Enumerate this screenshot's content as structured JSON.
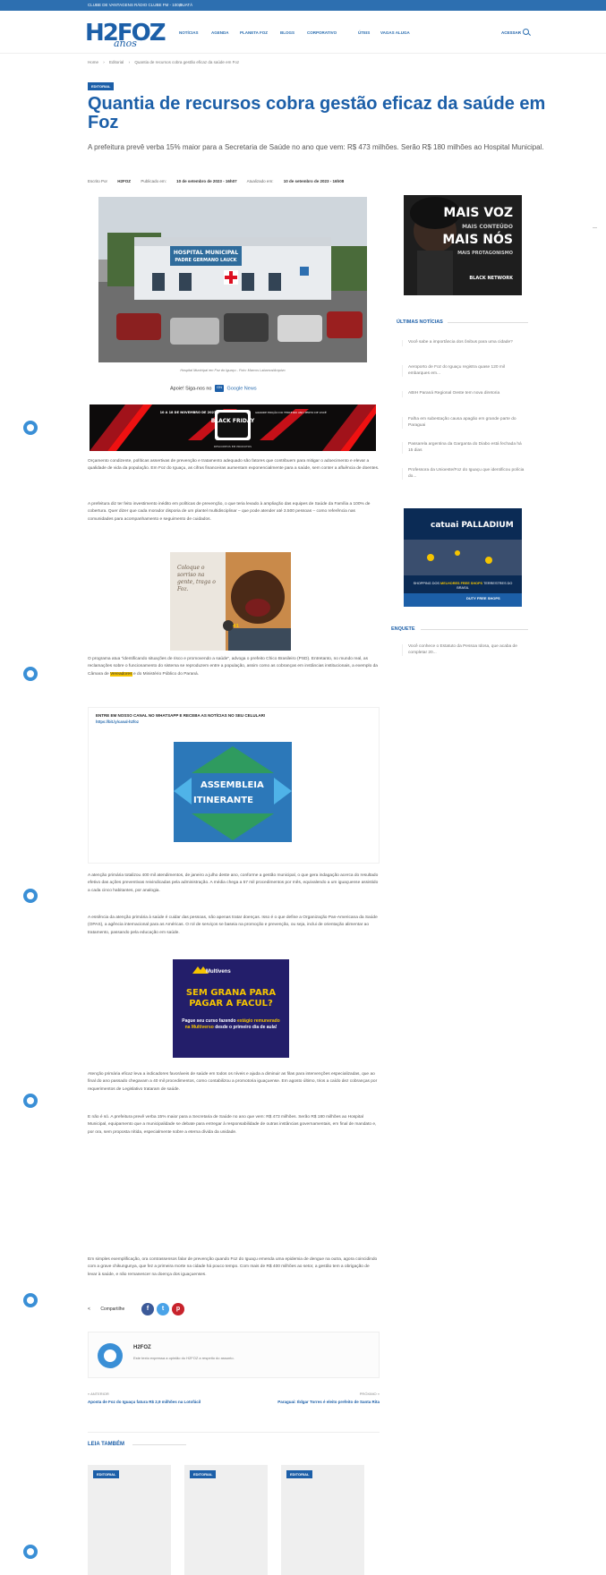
{
  "topbar": {
    "links": [
      "CLUBE DE VANTAGENS",
      "RÁDIO CLUBE FM - 100,9",
      "GUATÁ"
    ]
  },
  "header": {
    "logo_main": "H2FOZ",
    "logo_sub": "anos",
    "nav": [
      "NOTÍCIAS",
      "AGENDA",
      "PLANETA FOZ",
      "BLOGS",
      "CORPORATIVO",
      "ÚTEIS",
      "VAGAS ALUGA"
    ],
    "acessar": "ACESSAR",
    "search_icon": "search-icon"
  },
  "breadcrumb": [
    "Home",
    "›",
    "Editorial",
    "›",
    "Quantia de recursos cobra gestão eficaz da saúde em Foz"
  ],
  "article": {
    "category": "EDITORIAL",
    "title": "Quantia de recursos cobra gestão eficaz da saúde em Foz",
    "subtitle": "A prefeitura prevê verba 15% maior para a Secretaria de Saúde no ano que vem: R$ 473 milhões. Serão R$ 180 milhões ao Hospital Municipal.",
    "author_label": "Escrito Por",
    "author": "H2FOZ",
    "published_label": "Publicado em:",
    "published": "10 de setembro de 2023 - 16h07",
    "updated_label": "Atualizado em:",
    "updated": "10 de setembro de 2023 - 16h08",
    "hero_sign1": "HOSPITAL MUNICIPAL",
    "hero_sign2": "PADRE GERMANO LAUCK",
    "caption": "Hospital Municipal em Foz do Iguaçu - Foto: Marcos Labanca/Arquivo",
    "gnews_prefix": "Apoie! Siga-nos no",
    "gnews_icon": "google-news-icon",
    "gnews_text": "Google News",
    "banner": {
      "date": "10 A 18 DE NOVEMBRO DE 2023",
      "text": "BLACK FRIDAY",
      "right": "GRANDE EDIÇÃO DO TERCEIRO ANO PERTO DE VOCÊ",
      "footer": "DESCONTOS EM PRODUTOS"
    },
    "para1": "Orçamento condizente, políticas assertivas de prevenção e tratamento adequado são fatores que contribuem para mitigar o adoecimento e elevar a qualidade de vida da população. Em Foz do Iguaçu, as cifras financeiras aumentam exponencialmente para a saúde, sem conter a afluência de doentes.",
    "para2": "A prefeitura diz ter feito investimento inédito em políticas de prevenção, o que teria levado à ampliação das equipes de Saúde da Família a 100% de cobertura. Quer dizer que cada morador disporia de um plantel multidisciplinar – que pode atender até 3.500 pessoas – como referência nas comunidades para acompanhamento e seguimento de cuidados.",
    "ad_kid_text": "Coloque o sorriso na gente, traga o Foz.",
    "para3_a": "O programa atua \"identificando situações de risco e promovendo a saúde\", advoga o prefeito Chico Brasileiro (PSD). Entretanto, no mundo real, as reclamações sobre o funcionamento do sistema se reproduzem entre a população, assim como as cobranças em instâncias institucionais, a exemplo da Câmara de",
    "para3_hl": "Vereadores",
    "para3_b": "e do Ministério Público do Paraná.",
    "wa_title": "ENTRE EM NOSSO CANAL NO WHATSAPP E RECEBA AS NOTÍCIAS NO SEU CELULAR!",
    "wa_link": "https://bit.ly/canal-h2foz",
    "ad_ass_1": "ASSEMBLEIA",
    "ad_ass_2": "ITINERANTE",
    "para4": "A atenção primária totalizou 400 mil atendimentos, de janeiro a julho deste ano, conforme a gestão municipal, o que gera indagação acerca do resultado efetivo das ações preventivas reivindicadas pela administração. A média chega a 57 mil procedimentos por mês, equivalendo a um iguaçuense assistido a cada cinco habitantes, por analogia.",
    "para5": "A essência da atenção primária à saúde é cuidar das pessoas, não apenas tratar doenças. Isso é o que define a Organização Pan-Americana da Saúde (OPAS), a agência internacional para as Américas. O rol de serviços se baseia na promoção e prevenção, ou seja, inclui de orientação alimentar ao tratamento, passando pela educação em saúde.",
    "ad_mv_brand": "Multivens",
    "ad_mv_head": "SEM GRANA PARA PAGAR A FACUL?",
    "ad_mv_body_1": "Pague seu curso fazendo",
    "ad_mv_body_2": "estágio remunerado na Multiverso",
    "ad_mv_body_3": "desde o primeiro dia de aula!",
    "para6": "Atenção primária eficaz leva a indicadores favoráveis de saúde em todos os níveis e ajuda a diminuir as filas para intervenções especializadas, que ao final do ano passado chegavam a 40 mil procedimentos, como contabilizou a promotoria iguaçuense. Em agosto último, trios a caído dez cobranças por requerimentos de Legislativo trataram de saúde.",
    "para7": "E não é só. A prefeitura prevê verba 15% maior para a Secretaria de Saúde no ano que vem: R$ 473 milhões. Serão R$ 180 milhões ao Hospital Municipal, equipamento que a municipalidade se debate para entregar à responsabilidade de outras instâncias governamentais, em final de mandato e, por ora, sem proposta nítida, especialmente sobre a eterna dívida da unidade.",
    "para8": "Em simples exemplificação, ora contrassensos falar de prevenção quando Foz do Iguaçu emenda uma epidemia de dengue na outra, agora coincidindo com a grave chikungunya, que fez a primeira morte na cidade há pouco tempo. Com mais de R$ 400 milhões ao setor, a gestão tem a obrigação de levar à saúde, e não remanescer na doença dos iguaçuenses.",
    "share_label": "Compartilhe",
    "share_icons": [
      "facebook-icon",
      "twitter-icon",
      "pinterest-icon"
    ]
  },
  "author_box": {
    "name": "H2FOZ",
    "desc": "Este texto expressa a opinião do H2FOZ a respeito do assunto."
  },
  "prevnext": {
    "prev_label": "« ANTERIOR",
    "prev_title": "Aposta de Foz do Iguaçu fatura R$ 2,9 milhões na Lotofácil",
    "next_label": "PRÓXIMO »",
    "next_title": "Paraguai: Édgar Torres é eleito prefeito de Santa Rita"
  },
  "leia": {
    "heading": "LEIA TAMBÉM",
    "cards": [
      "EDITORIAL",
      "EDITORIAL",
      "EDITORIAL"
    ]
  },
  "sidebar": {
    "ad1": {
      "l1": "MAIS VOZ",
      "l2": "MAIS CONTEÚDO",
      "l3": "MAIS NÓS",
      "l4": "MAIS PROTAGONISMO",
      "l5": "BLACK NETWORK"
    },
    "ultimas_heading": "ÚLTIMAS NOTÍCIAS",
    "ultimas": [
      "Você sabe a importância dos ônibus para uma cidade?",
      "Aeroporto de Foz do Iguaçu registra quase 120 mil embarques em...",
      "ABIH Paraná Regional Oeste tem nova diretoria",
      "Falha em subestação causa apagão em grande parte do Paraguai",
      "Passarela argentina da Garganta do Diabo está fechada há 15 dias",
      "Professora da Unioeste/Foz do Iguaçu que identificou polícia do..."
    ],
    "ad2": {
      "brand": "catuai PALLADIUM",
      "text_a": "SHOPPING DOS",
      "text_b": "MELHORES FREE SHOPS",
      "text_c": "TERRESTRES DO BRASIL",
      "duty": "DUTY FREE SHOPS"
    },
    "enquete_heading": "ENQUETE",
    "enquete_text": "Você conhece o Estatuto da Pessoa Idosa, que acaba de completar 20..."
  },
  "colors": {
    "brand": "#1c5fa8",
    "topbar": "#2d6fb0",
    "highlight": "#f5c400"
  }
}
